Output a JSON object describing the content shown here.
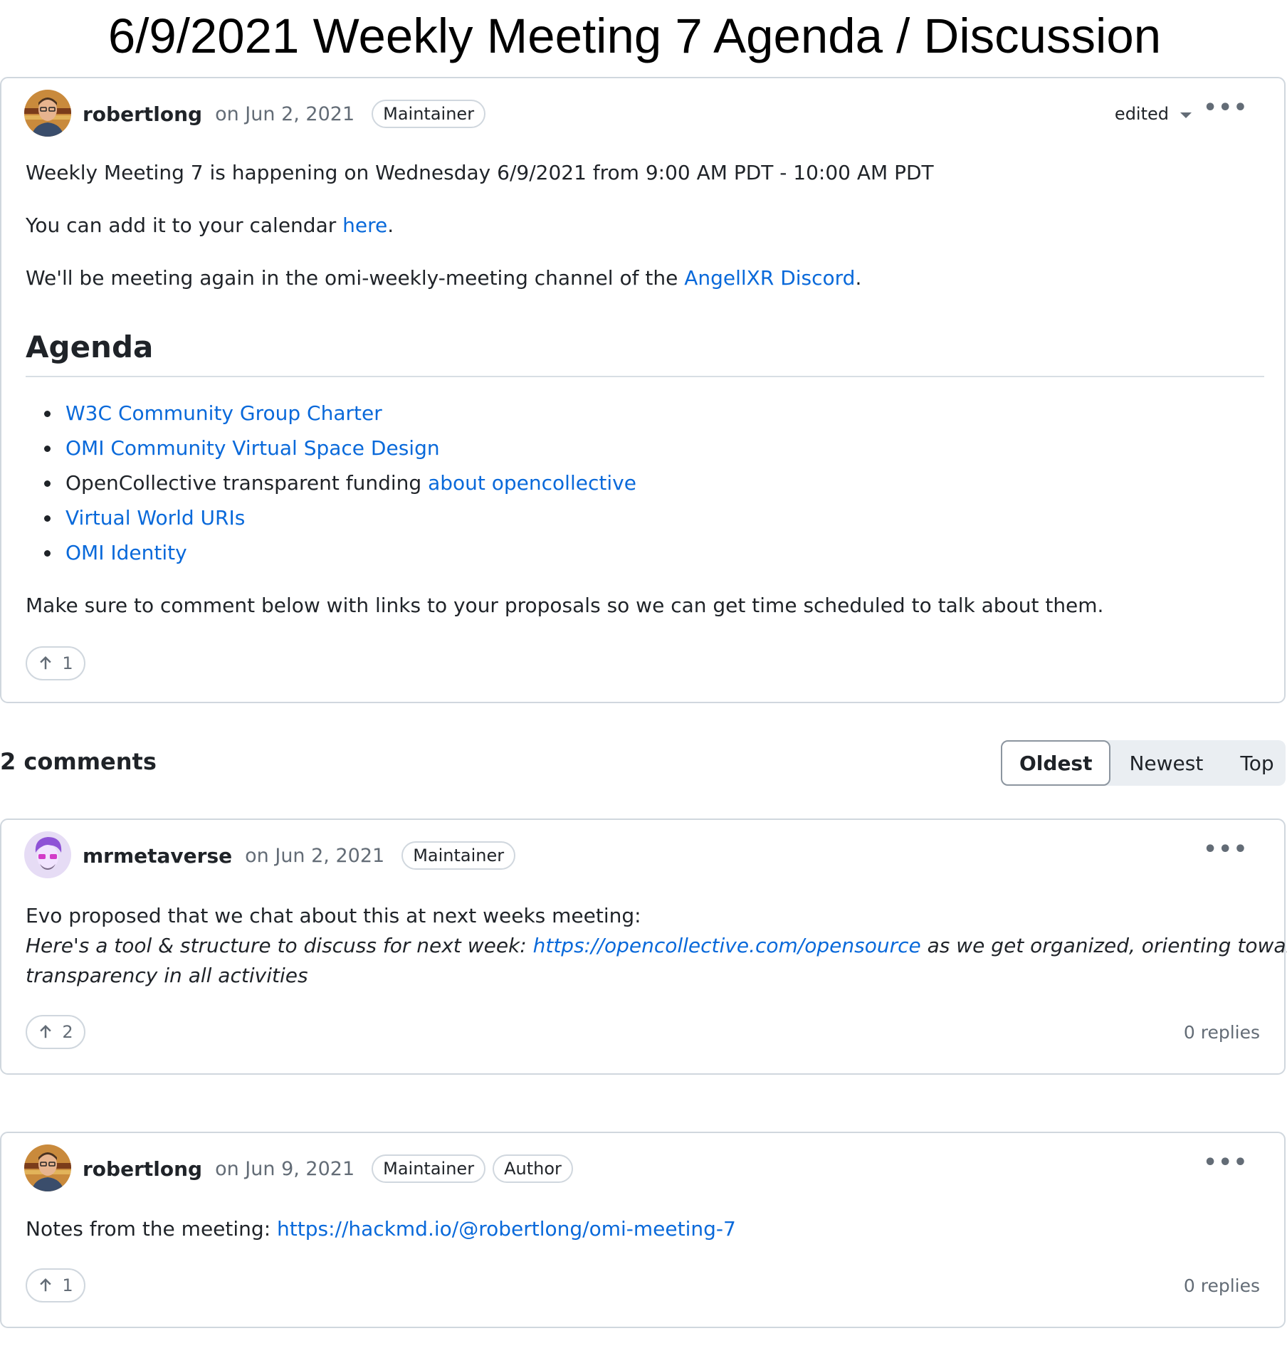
{
  "page_title": "6/9/2021 Weekly Meeting 7 Agenda / Discussion",
  "post": {
    "author": "robertlong",
    "date": "on Jun 2, 2021",
    "badges": [
      "Maintainer"
    ],
    "edited_label": "edited",
    "more_label": "•••",
    "line1": "Weekly Meeting 7 is happening on Wednesday 6/9/2021 from 9:00 AM PDT - 10:00 AM PDT",
    "line2_prefix": "You can add it to your calendar ",
    "line2_link": "here",
    "line2_suffix": ".",
    "line3_prefix": "We'll be meeting again in the omi-weekly-meeting channel of the ",
    "line3_link": "AngellXR Discord",
    "line3_suffix": ".",
    "heading": "Agenda",
    "agenda": [
      {
        "text": "",
        "link": "W3C Community Group Charter"
      },
      {
        "text": "",
        "link": "OMI Community Virtual Space Design"
      },
      {
        "text": "OpenCollective transparent funding ",
        "link": "about opencollective"
      },
      {
        "text": "",
        "link": "Virtual World URIs"
      },
      {
        "text": "",
        "link": "OMI Identity"
      }
    ],
    "closing": "Make sure to comment below with links to your proposals so we can get time scheduled to talk about them.",
    "upvotes": "1"
  },
  "comments_header": {
    "count_label": "2 comments",
    "sort_options": [
      "Oldest",
      "Newest",
      "Top"
    ],
    "selected": "Oldest"
  },
  "comments": [
    {
      "author": "mrmetaverse",
      "date": "on Jun 2, 2021",
      "badges": [
        "Maintainer"
      ],
      "more_label": "•••",
      "line1": "Evo proposed that we chat about this at next weeks meeting:",
      "quote_prefix": "Here's a tool & structure to discuss for next week: ",
      "quote_link": "https://opencollective.com/opensource",
      "quote_suffix": " as we get organized, orienting toward",
      "quote_line2": "transparency in all activities",
      "upvotes": "2",
      "replies": "0 replies"
    },
    {
      "author": "robertlong",
      "date": "on Jun 9, 2021",
      "badges": [
        "Maintainer",
        "Author"
      ],
      "more_label": "•••",
      "line1_prefix": "Notes from the meeting: ",
      "line1_link": "https://hackmd.io/@robertlong/omi-meeting-7",
      "upvotes": "1",
      "replies": "0 replies"
    }
  ],
  "colors": {
    "link": "#0969da",
    "border": "#d0d7de",
    "muted": "#636c76"
  }
}
